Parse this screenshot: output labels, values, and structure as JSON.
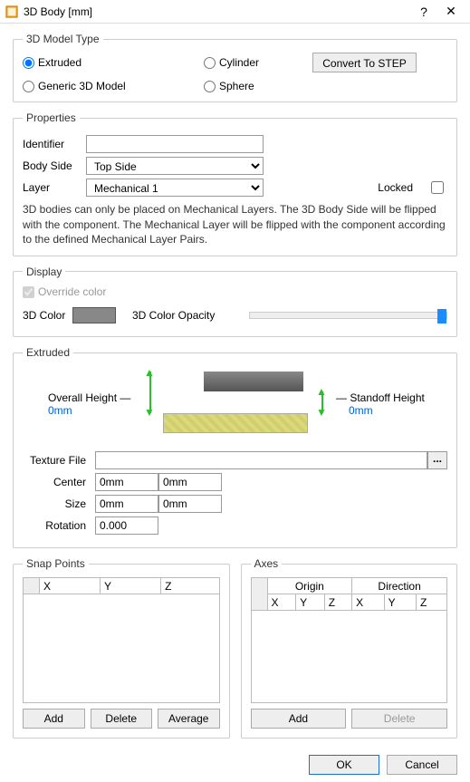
{
  "window": {
    "title": "3D Body [mm]"
  },
  "modelType": {
    "legend": "3D Model Type",
    "extruded": "Extruded",
    "generic": "Generic 3D Model",
    "cylinder": "Cylinder",
    "sphere": "Sphere",
    "convertBtn": "Convert To STEP"
  },
  "properties": {
    "legend": "Properties",
    "identifier": "Identifier",
    "bodySide": "Body Side",
    "bodySideValue": "Top Side",
    "layer": "Layer",
    "layerValue": "Mechanical 1",
    "locked": "Locked",
    "help": "3D bodies can only be placed on Mechanical Layers. The 3D Body Side will be flipped with the component. The Mechanical Layer will be flipped with the component according to the defined Mechanical Layer Pairs."
  },
  "display": {
    "legend": "Display",
    "override": "Override color",
    "color": "3D Color",
    "opacity": "3D Color Opacity"
  },
  "extruded": {
    "legend": "Extruded",
    "overallHeight": "Overall Height",
    "overallHeightVal": "0mm",
    "standoffHeight": "Standoff Height",
    "standoffHeightVal": "0mm",
    "textureFile": "Texture File",
    "center": "Center",
    "centerX": "0mm",
    "centerY": "0mm",
    "size": "Size",
    "sizeX": "0mm",
    "sizeY": "0mm",
    "rotation": "Rotation",
    "rotationVal": "0.000",
    "browse": "..."
  },
  "snap": {
    "legend": "Snap Points",
    "cols": {
      "x": "X",
      "y": "Y",
      "z": "Z"
    },
    "add": "Add",
    "delete": "Delete",
    "average": "Average"
  },
  "axes": {
    "legend": "Axes",
    "origin": "Origin",
    "direction": "Direction",
    "cols": {
      "x": "X",
      "y": "Y",
      "z": "Z"
    },
    "add": "Add",
    "delete": "Delete"
  },
  "buttons": {
    "ok": "OK",
    "cancel": "Cancel"
  }
}
